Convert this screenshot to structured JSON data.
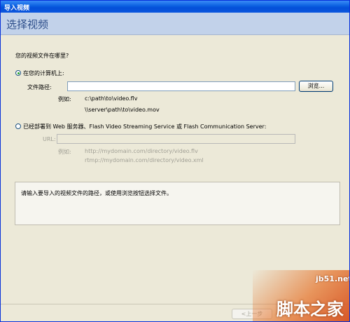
{
  "window": {
    "title": "导入视频"
  },
  "header": {
    "title": "选择视频"
  },
  "question": "您的视频文件在哪里?",
  "local": {
    "radio_label": "在您的计算机上:",
    "path_label": "文件路径:",
    "path_value": "",
    "browse_label": "浏览...",
    "example_label": "例如:",
    "example_1": "c:\\path\\to\\video.flv",
    "example_2": "\\\\server\\path\\to\\video.mov"
  },
  "server": {
    "radio_label": "已经部署到 Web 服务器、Flash Video Streaming Service 或 Flash Communication Server:",
    "url_label": "URL:",
    "url_value": "",
    "example_label": "例如:",
    "example_1": "http://mydomain.com/directory/video.flv",
    "example_2": "rtmp://mydomain.com/directory/video.xml"
  },
  "message": "请输入要导入的视频文件的路径，或使用浏览按钮选择文件。",
  "footer": {
    "back_label": "<上一步"
  },
  "watermark": {
    "site": "jb51.net",
    "brand": "脚本之家"
  },
  "colors": {
    "title_bar": "#0a5fe0",
    "header_bg": "#c2d2ea",
    "header_text": "#2e4f8b",
    "dialog_bg": "#ece9d8"
  }
}
